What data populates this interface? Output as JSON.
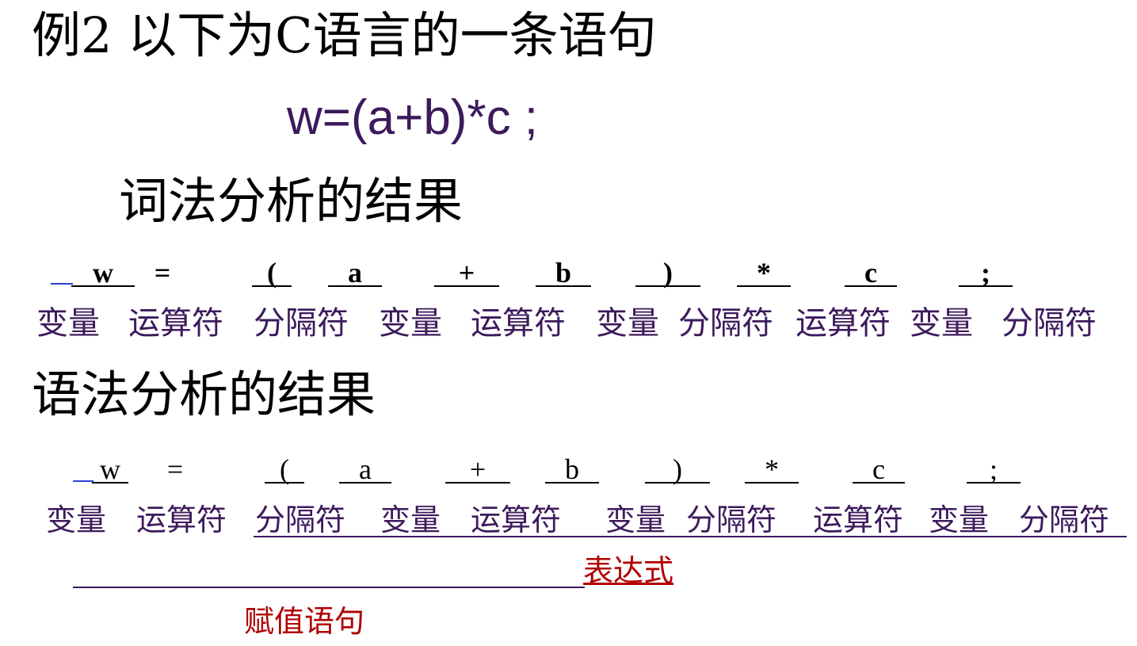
{
  "title": "例2 以下为C语言的一条语句",
  "code_statement": "w=(a+b)*c ;",
  "lexical": {
    "heading": "词法分析的结果",
    "tokens": [
      "w",
      "=",
      "(",
      "a",
      "+",
      "b",
      ")",
      "*",
      "c",
      ";"
    ],
    "categories": [
      "变量",
      "运算符",
      "分隔符",
      "变量",
      "运算符",
      "变量",
      "分隔符",
      "运算符",
      "变量",
      "分隔符"
    ]
  },
  "syntax": {
    "heading": "语法分析的结果",
    "tokens": [
      "w",
      "=",
      "(",
      "a",
      "+",
      "b",
      ")",
      "*",
      "c",
      ";"
    ],
    "categories": [
      "变量",
      "运算符",
      "分隔符",
      "变量",
      "运算符",
      "变量",
      "分隔符",
      "运算符",
      "变量",
      "分隔符"
    ],
    "expression_label": "表达式",
    "assignment_label": "赋值语句"
  },
  "colors": {
    "purple": "#3d1a5c",
    "red": "#b00000",
    "blue": "#2a3fd6"
  }
}
